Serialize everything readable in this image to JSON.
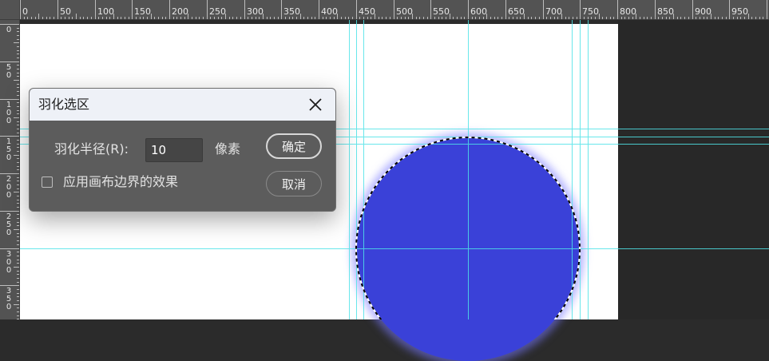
{
  "ruler": {
    "top_labels": [
      "0",
      "50",
      "100",
      "150",
      "200",
      "250",
      "300",
      "350",
      "400",
      "450",
      "500",
      "550",
      "600",
      "650",
      "700",
      "750",
      "800",
      "850",
      "900",
      "950"
    ],
    "left_labels": [
      "0",
      "50",
      "100",
      "150",
      "200",
      "250",
      "300",
      "350"
    ]
  },
  "dialog": {
    "title": "羽化选区",
    "radius_label": "羽化半径(R):",
    "radius_value": "10",
    "unit": "像素",
    "checkbox_label": "应用画布边界的效果",
    "checkbox_checked": false,
    "ok_label": "确定",
    "cancel_label": "取消"
  },
  "canvas": {
    "circle_color": "#3a41d8",
    "guide_color": "#4fe3e8"
  },
  "icons": {
    "close": "close-icon"
  }
}
